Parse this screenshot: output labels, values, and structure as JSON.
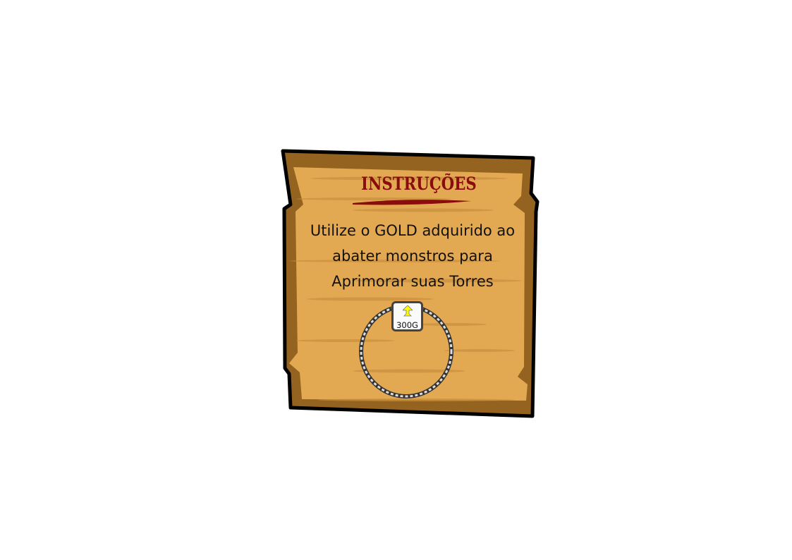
{
  "panel": {
    "title": "INSTRUÇÕES",
    "lines": [
      "Utilize o GOLD adquirido ao",
      "abater monstros para",
      "Aprimorar suas Torres"
    ]
  },
  "upgrade_button": {
    "cost": "300G",
    "icon": "upgrade-arrow-icon"
  },
  "colors": {
    "wood_dark": "#93631f",
    "wood_light": "#e3a952",
    "title": "#8a0c0c",
    "arrow": "#ffff00"
  }
}
